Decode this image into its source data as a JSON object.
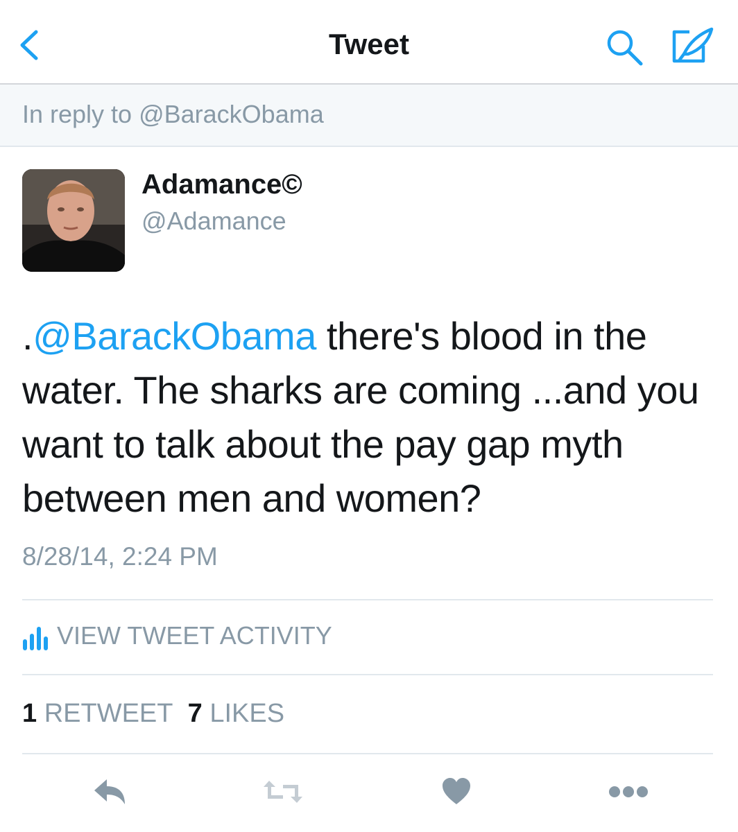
{
  "nav": {
    "title": "Tweet",
    "icons": [
      "back-chevron-icon",
      "search-icon",
      "compose-tweet-icon"
    ],
    "accent_color": "#1da1f2"
  },
  "reply": {
    "text": "In reply to @BarackObama"
  },
  "tweet": {
    "author_name": "Adamance©",
    "author_handle": "@Adamance",
    "mention": "@BarackObama",
    "text_prefix": ".",
    "text_rest": " there's blood in the water. The sharks are coming ...and you want to talk about the pay gap myth between men and women?",
    "timestamp": "8/28/14, 2:24 PM"
  },
  "activity": {
    "label": "VIEW TWEET ACTIVITY",
    "icon": "bar-chart-icon"
  },
  "stats": {
    "retweet_count": "1",
    "retweet_label": "RETWEET",
    "likes_count": "7",
    "likes_label": "LIKES"
  },
  "actions": {
    "icons": [
      "reply-icon",
      "retweet-icon",
      "like-heart-icon",
      "more-dots-icon"
    ],
    "icon_color": "#8899a6"
  }
}
